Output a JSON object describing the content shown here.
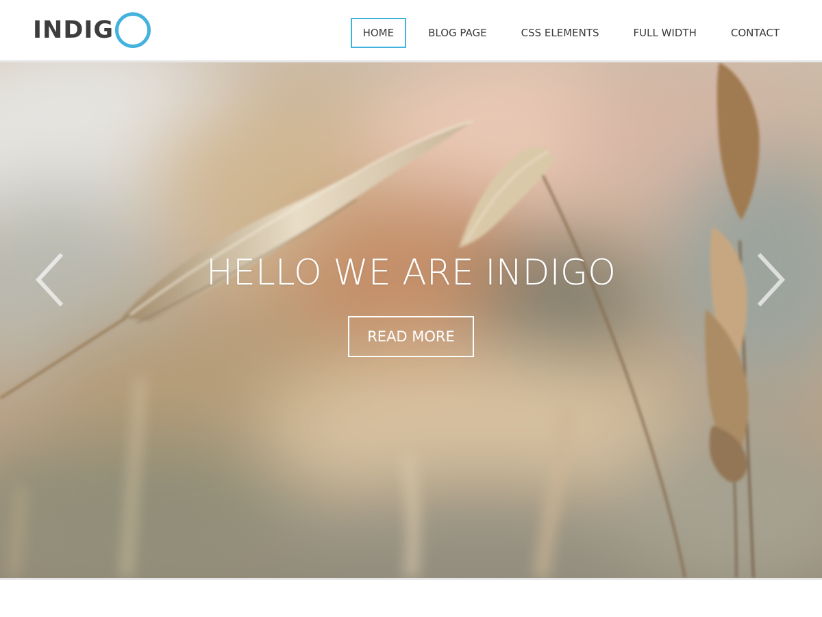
{
  "brand": {
    "name": "INDIG",
    "accent_color": "#43b2dc"
  },
  "nav": {
    "items": [
      {
        "label": "HOME",
        "active": true
      },
      {
        "label": "BLOG PAGE",
        "active": false
      },
      {
        "label": "CSS ELEMENTS",
        "active": false
      },
      {
        "label": "FULL WIDTH",
        "active": false
      },
      {
        "label": "CONTACT",
        "active": false
      }
    ]
  },
  "hero": {
    "title": "HELLO WE ARE INDIGO",
    "button_label": "READ MORE",
    "prev_icon": "chevron-left-icon",
    "next_icon": "chevron-right-icon",
    "background": "blurred photo of wheat stalks in a field"
  }
}
